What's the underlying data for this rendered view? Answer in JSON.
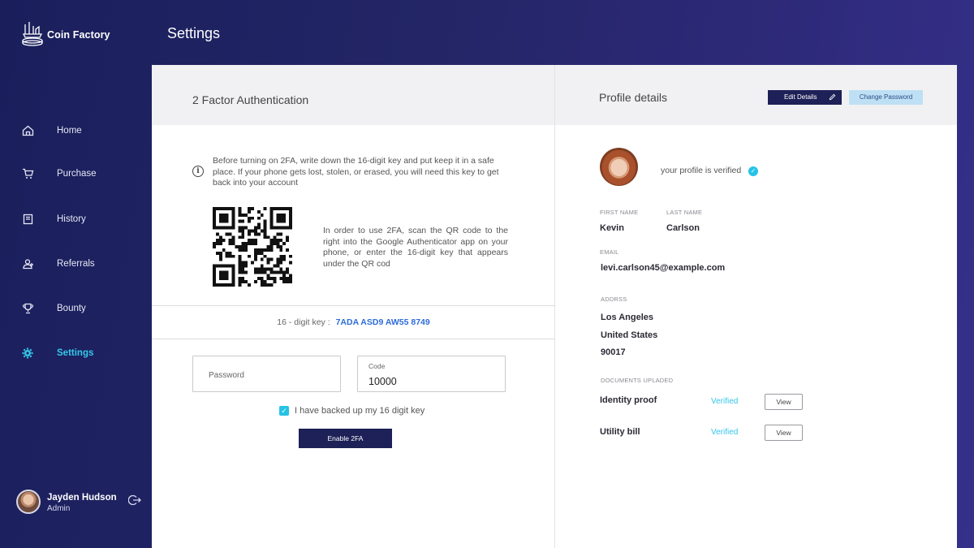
{
  "app": {
    "name": "Coin Factory"
  },
  "page": {
    "title": "Settings"
  },
  "sidebar": {
    "items": [
      {
        "label": "Home",
        "icon": "home-icon"
      },
      {
        "label": "Purchase",
        "icon": "cart-icon"
      },
      {
        "label": "History",
        "icon": "book-icon"
      },
      {
        "label": "Referrals",
        "icon": "referrals-icon"
      },
      {
        "label": "Bounty",
        "icon": "trophy-icon"
      },
      {
        "label": "Settings",
        "icon": "gear-icon",
        "active": true
      }
    ],
    "user": {
      "name": "Jayden Hudson",
      "role": "Admin"
    }
  },
  "two_factor": {
    "title": "2 Factor Authentication",
    "info": "Before turning on 2FA, write down the 16-digit key and put keep it in a safe place. If your phone gets lost, stolen, or erased, you will need this key to get back into your account",
    "qr_instructions": "In order to use 2FA, scan the QR code to the right into the Google Authenticator app on your phone, or enter the 16-digit key that appears under the QR cod",
    "key_label": "16 - digit key :",
    "key_value": "7ADA ASD9 AW55 8749",
    "password_placeholder": "Password",
    "code_label": "Code",
    "code_value": "10000",
    "backup_label": "I have backed up my 16 digit key",
    "backup_checked": true,
    "enable_button": "Enable 2FA"
  },
  "profile": {
    "title": "Profile details",
    "edit_button": "Edit Details",
    "change_password_button": "Change Password",
    "verified_text": "your profile is verified",
    "first_name_label": "FIRST NAME",
    "first_name": "Kevin",
    "last_name_label": "LAST NAME",
    "last_name": "Carlson",
    "email_label": "EMAIL",
    "email": "levi.carlson45@example.com",
    "address_label": "ADDRSS",
    "address_city": "Los Angeles",
    "address_country": "United States",
    "address_zip": "90017",
    "documents_label": "DOCUMENTS UPLADED",
    "documents": [
      {
        "name": "Identity proof",
        "status": "Verified",
        "action": "View"
      },
      {
        "name": "Utility bill",
        "status": "Verified",
        "action": "View"
      }
    ]
  },
  "colors": {
    "sidebar_bg": "#1a1f5c",
    "accent": "#35c7ea",
    "primary_button": "#1d2157",
    "key_blue": "#2d6cd8",
    "secondary_button": "#bfe0f4"
  }
}
